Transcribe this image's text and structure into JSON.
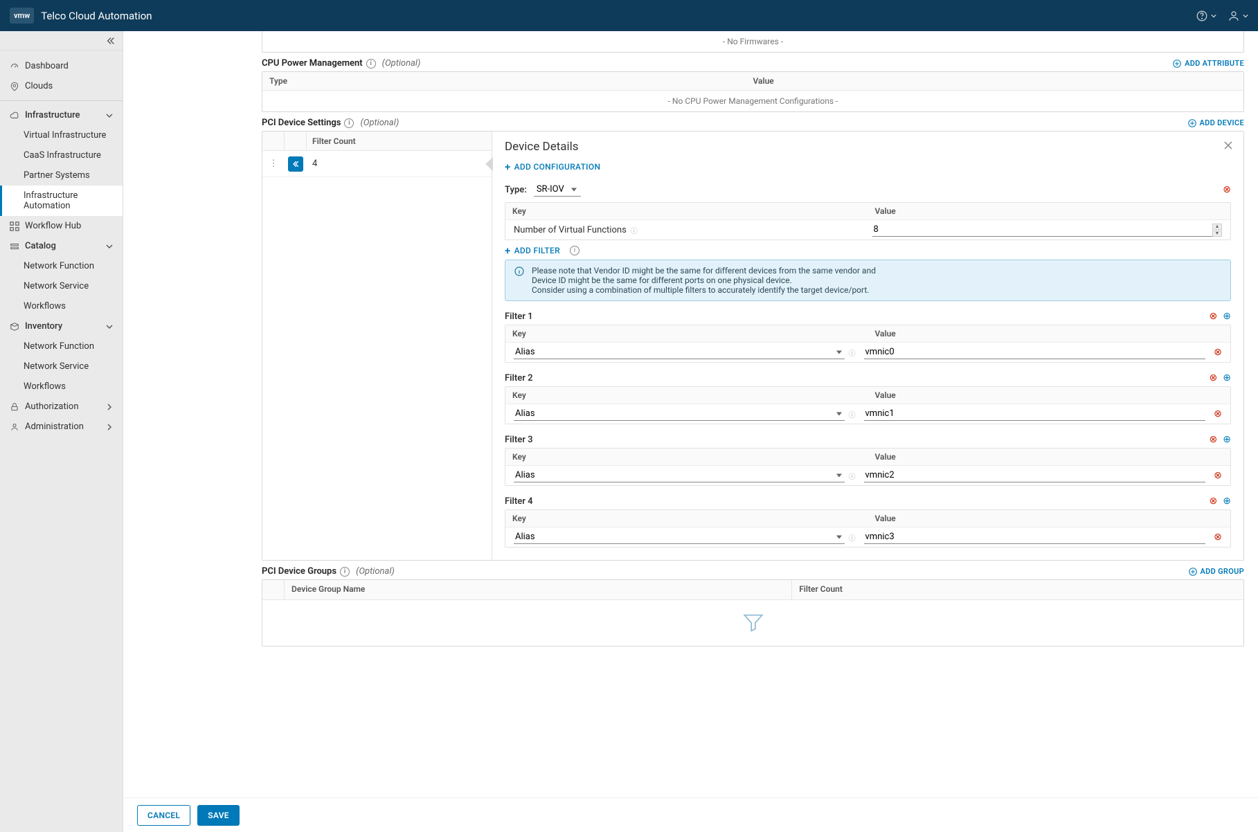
{
  "app_title": "Telco Cloud Automation",
  "logo": "vmw",
  "sidebar": {
    "dashboard": "Dashboard",
    "clouds": "Clouds",
    "infra": "Infrastructure",
    "infra_items": [
      "Virtual Infrastructure",
      "CaaS Infrastructure",
      "Partner Systems",
      "Infrastructure Automation"
    ],
    "workflow_hub": "Workflow Hub",
    "catalog": "Catalog",
    "catalog_items": [
      "Network Function",
      "Network Service",
      "Workflows"
    ],
    "inventory": "Inventory",
    "inventory_items": [
      "Network Function",
      "Network Service",
      "Workflows"
    ],
    "authorization": "Authorization",
    "administration": "Administration"
  },
  "section_firmwares": "- No Firmwares -",
  "cpu": {
    "title": "CPU Power Management",
    "optional": "(Optional)",
    "add": "ADD ATTRIBUTE",
    "hdr_type": "Type",
    "hdr_value": "Value",
    "empty": "- No CPU Power Management Configurations -"
  },
  "pci": {
    "title": "PCI Device Settings",
    "optional": "(Optional)",
    "add": "ADD DEVICE",
    "filter_count_hdr": "Filter Count",
    "row_count": "4",
    "device_details": "Device Details",
    "add_configuration": "ADD CONFIGURATION",
    "type_label": "Type:",
    "type_value": "SR-IOV",
    "kv_key": "Key",
    "kv_value": "Value",
    "nvf_label": "Number of Virtual Functions",
    "nvf_value": "8",
    "add_filter": "ADD FILTER",
    "info_l1": "Please note that Vendor ID might be the same for different devices from the same vendor and",
    "info_l2": "Device ID might be the same for different ports on one physical device.",
    "info_l3": "Consider using a combination of multiple filters to accurately identify the target device/port.",
    "filters": [
      {
        "title": "Filter 1",
        "key": "Alias",
        "value": "vmnic0"
      },
      {
        "title": "Filter 2",
        "key": "Alias",
        "value": "vmnic1"
      },
      {
        "title": "Filter 3",
        "key": "Alias",
        "value": "vmnic2"
      },
      {
        "title": "Filter 4",
        "key": "Alias",
        "value": "vmnic3"
      }
    ]
  },
  "groups": {
    "title": "PCI Device Groups",
    "optional": "(Optional)",
    "add": "ADD GROUP",
    "hdr_name": "Device Group Name",
    "hdr_count": "Filter Count"
  },
  "footer": {
    "cancel": "CANCEL",
    "save": "SAVE"
  }
}
